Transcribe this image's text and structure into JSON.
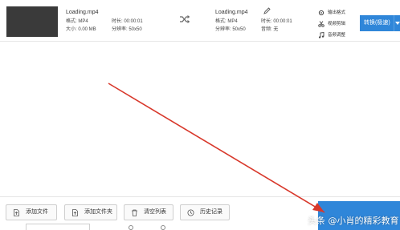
{
  "file": {
    "source": {
      "name": "Loading.mp4",
      "format_label": "格式: MP4",
      "duration_label": "时长: 00:00:01",
      "size_label": "大小: 0.00 MB",
      "resolution_label": "分辨率: 50x50"
    },
    "output": {
      "name": "Loading.mp4",
      "format_label": "格式: MP4",
      "duration_label": "时长: 00:00:01",
      "resolution_label": "分辨率: 50x50",
      "audio_label": "音频: 无"
    }
  },
  "side_actions": [
    {
      "label": "输出格式",
      "icon": "gear-icon"
    },
    {
      "label": "视频剪辑",
      "icon": "scissors-icon"
    },
    {
      "label": "音频调整",
      "icon": "music-icon"
    }
  ],
  "convert_button": {
    "label": "转换(极速)"
  },
  "toolbar": {
    "add_file": "添加文件",
    "add_folder": "添加文件夹",
    "clear_list": "清空列表",
    "history": "历史记录"
  },
  "watermark": "头条 @小肖的精彩教育",
  "colors": {
    "accent": "#2f86d9",
    "annotation_arrow": "#d8382b"
  }
}
